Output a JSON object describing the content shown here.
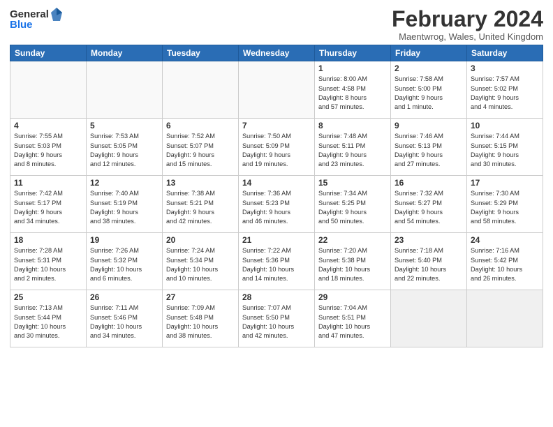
{
  "header": {
    "logo_general": "General",
    "logo_blue": "Blue",
    "month_year": "February 2024",
    "location": "Maentwrog, Wales, United Kingdom"
  },
  "days_of_week": [
    "Sunday",
    "Monday",
    "Tuesday",
    "Wednesday",
    "Thursday",
    "Friday",
    "Saturday"
  ],
  "weeks": [
    [
      {
        "day": "",
        "info": ""
      },
      {
        "day": "",
        "info": ""
      },
      {
        "day": "",
        "info": ""
      },
      {
        "day": "",
        "info": ""
      },
      {
        "day": "1",
        "info": "Sunrise: 8:00 AM\nSunset: 4:58 PM\nDaylight: 8 hours\nand 57 minutes."
      },
      {
        "day": "2",
        "info": "Sunrise: 7:58 AM\nSunset: 5:00 PM\nDaylight: 9 hours\nand 1 minute."
      },
      {
        "day": "3",
        "info": "Sunrise: 7:57 AM\nSunset: 5:02 PM\nDaylight: 9 hours\nand 4 minutes."
      }
    ],
    [
      {
        "day": "4",
        "info": "Sunrise: 7:55 AM\nSunset: 5:03 PM\nDaylight: 9 hours\nand 8 minutes."
      },
      {
        "day": "5",
        "info": "Sunrise: 7:53 AM\nSunset: 5:05 PM\nDaylight: 9 hours\nand 12 minutes."
      },
      {
        "day": "6",
        "info": "Sunrise: 7:52 AM\nSunset: 5:07 PM\nDaylight: 9 hours\nand 15 minutes."
      },
      {
        "day": "7",
        "info": "Sunrise: 7:50 AM\nSunset: 5:09 PM\nDaylight: 9 hours\nand 19 minutes."
      },
      {
        "day": "8",
        "info": "Sunrise: 7:48 AM\nSunset: 5:11 PM\nDaylight: 9 hours\nand 23 minutes."
      },
      {
        "day": "9",
        "info": "Sunrise: 7:46 AM\nSunset: 5:13 PM\nDaylight: 9 hours\nand 27 minutes."
      },
      {
        "day": "10",
        "info": "Sunrise: 7:44 AM\nSunset: 5:15 PM\nDaylight: 9 hours\nand 30 minutes."
      }
    ],
    [
      {
        "day": "11",
        "info": "Sunrise: 7:42 AM\nSunset: 5:17 PM\nDaylight: 9 hours\nand 34 minutes."
      },
      {
        "day": "12",
        "info": "Sunrise: 7:40 AM\nSunset: 5:19 PM\nDaylight: 9 hours\nand 38 minutes."
      },
      {
        "day": "13",
        "info": "Sunrise: 7:38 AM\nSunset: 5:21 PM\nDaylight: 9 hours\nand 42 minutes."
      },
      {
        "day": "14",
        "info": "Sunrise: 7:36 AM\nSunset: 5:23 PM\nDaylight: 9 hours\nand 46 minutes."
      },
      {
        "day": "15",
        "info": "Sunrise: 7:34 AM\nSunset: 5:25 PM\nDaylight: 9 hours\nand 50 minutes."
      },
      {
        "day": "16",
        "info": "Sunrise: 7:32 AM\nSunset: 5:27 PM\nDaylight: 9 hours\nand 54 minutes."
      },
      {
        "day": "17",
        "info": "Sunrise: 7:30 AM\nSunset: 5:29 PM\nDaylight: 9 hours\nand 58 minutes."
      }
    ],
    [
      {
        "day": "18",
        "info": "Sunrise: 7:28 AM\nSunset: 5:31 PM\nDaylight: 10 hours\nand 2 minutes."
      },
      {
        "day": "19",
        "info": "Sunrise: 7:26 AM\nSunset: 5:32 PM\nDaylight: 10 hours\nand 6 minutes."
      },
      {
        "day": "20",
        "info": "Sunrise: 7:24 AM\nSunset: 5:34 PM\nDaylight: 10 hours\nand 10 minutes."
      },
      {
        "day": "21",
        "info": "Sunrise: 7:22 AM\nSunset: 5:36 PM\nDaylight: 10 hours\nand 14 minutes."
      },
      {
        "day": "22",
        "info": "Sunrise: 7:20 AM\nSunset: 5:38 PM\nDaylight: 10 hours\nand 18 minutes."
      },
      {
        "day": "23",
        "info": "Sunrise: 7:18 AM\nSunset: 5:40 PM\nDaylight: 10 hours\nand 22 minutes."
      },
      {
        "day": "24",
        "info": "Sunrise: 7:16 AM\nSunset: 5:42 PM\nDaylight: 10 hours\nand 26 minutes."
      }
    ],
    [
      {
        "day": "25",
        "info": "Sunrise: 7:13 AM\nSunset: 5:44 PM\nDaylight: 10 hours\nand 30 minutes."
      },
      {
        "day": "26",
        "info": "Sunrise: 7:11 AM\nSunset: 5:46 PM\nDaylight: 10 hours\nand 34 minutes."
      },
      {
        "day": "27",
        "info": "Sunrise: 7:09 AM\nSunset: 5:48 PM\nDaylight: 10 hours\nand 38 minutes."
      },
      {
        "day": "28",
        "info": "Sunrise: 7:07 AM\nSunset: 5:50 PM\nDaylight: 10 hours\nand 42 minutes."
      },
      {
        "day": "29",
        "info": "Sunrise: 7:04 AM\nSunset: 5:51 PM\nDaylight: 10 hours\nand 47 minutes."
      },
      {
        "day": "",
        "info": ""
      },
      {
        "day": "",
        "info": ""
      }
    ]
  ]
}
